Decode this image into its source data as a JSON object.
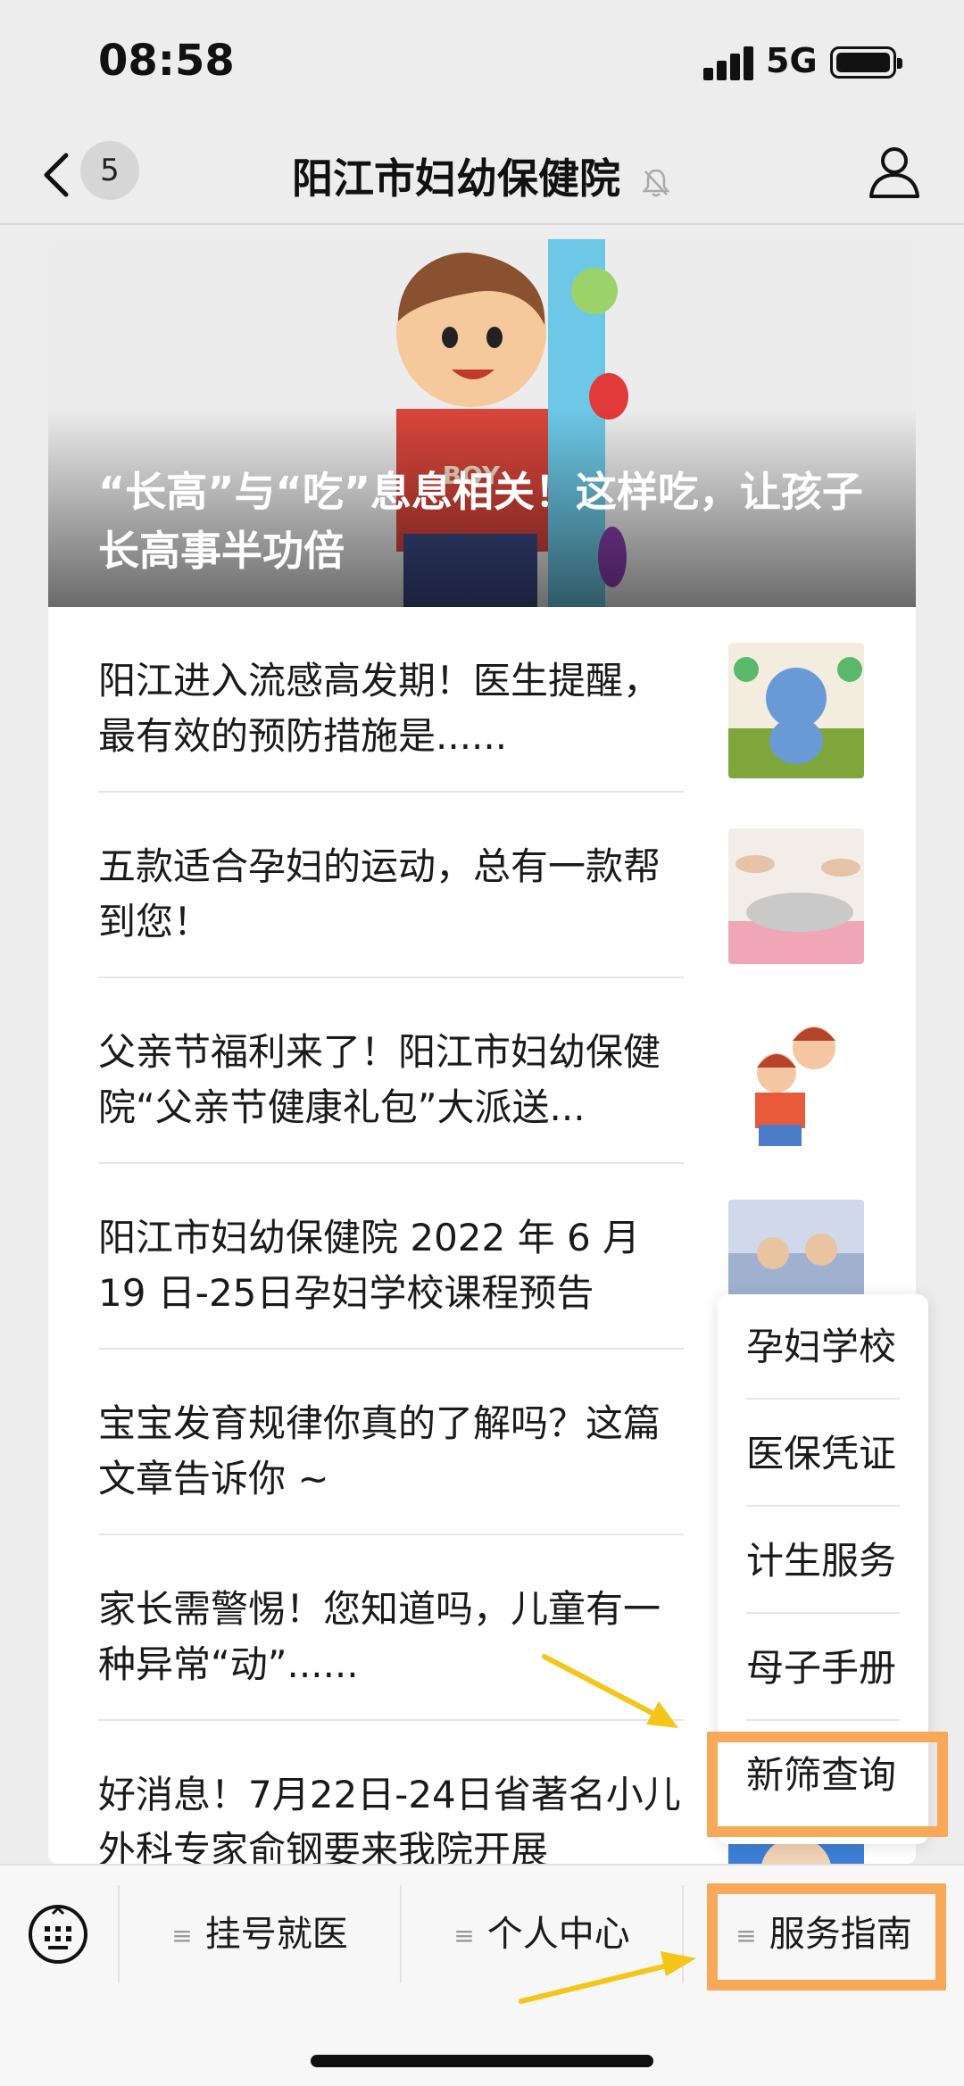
{
  "status_bar": {
    "time": "08:58",
    "network": "5G"
  },
  "nav": {
    "unread_count": "5",
    "title": "阳江市妇幼保健院"
  },
  "cover": {
    "title": "“长高”与“吃”息息相关！这样吃，让孩子长高事半功倍"
  },
  "articles": [
    {
      "title": "阳江进入流感高发期！医生提醒，最有效的预防措施是......"
    },
    {
      "title": "五款适合孕妇的运动，总有一款帮到您！"
    },
    {
      "title": "父亲节福利来了！阳江市妇幼保健院“父亲节健康礼包”大派送..."
    },
    {
      "title": "阳江市妇幼保健院 2022 年 6 月 19 日-25日孕妇学校课程预告"
    },
    {
      "title": "宝宝发育规律你真的了解吗？这篇文章告诉你 ~"
    },
    {
      "title": "家长需警惕！您知道吗，儿童有一种异常“动”......"
    },
    {
      "title": "好消息！7月22日-24日省著名小儿外科专家俞钢要来我院开展"
    }
  ],
  "popup_menu": {
    "items": [
      "孕妇学校",
      "医保凭证",
      "计生服务",
      "母子手册",
      "新筛查询"
    ]
  },
  "menu_bar": {
    "items": [
      "挂号就医",
      "个人中心",
      "服务指南"
    ]
  },
  "colors": {
    "highlight": "#f7a858",
    "arrow": "#f5c518"
  },
  "icons": [
    "back-icon",
    "bell-muted-icon",
    "profile-icon",
    "keyboard-icon",
    "menu-lines-icon"
  ]
}
